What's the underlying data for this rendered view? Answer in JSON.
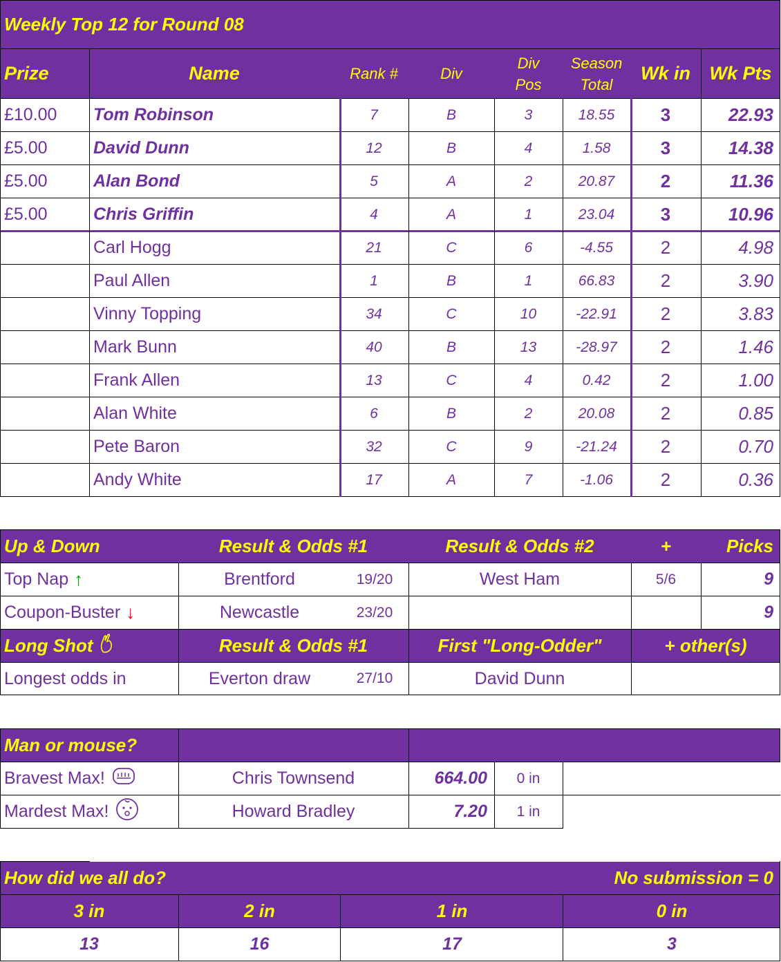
{
  "title": "Weekly Top 12 for Round 08",
  "top12": {
    "headers": {
      "prize": "Prize",
      "name": "Name",
      "rank": "Rank #",
      "div": "Div",
      "divpos_1": "Div",
      "divpos_2": "Pos",
      "season_1": "Season",
      "season_2": "Total",
      "wkin": "Wk in",
      "wkpts": "Wk Pts"
    },
    "rows": [
      {
        "prize": "£10.00",
        "name": "Tom Robinson",
        "rank": "7",
        "div": "B",
        "divpos": "3",
        "season": "18.55",
        "wkin": "3",
        "wkpts": "22.93"
      },
      {
        "prize": "£5.00",
        "name": "David Dunn",
        "rank": "12",
        "div": "B",
        "divpos": "4",
        "season": "1.58",
        "wkin": "3",
        "wkpts": "14.38"
      },
      {
        "prize": "£5.00",
        "name": "Alan Bond",
        "rank": "5",
        "div": "A",
        "divpos": "2",
        "season": "20.87",
        "wkin": "2",
        "wkpts": "11.36"
      },
      {
        "prize": "£5.00",
        "name": "Chris Griffin",
        "rank": "4",
        "div": "A",
        "divpos": "1",
        "season": "23.04",
        "wkin": "3",
        "wkpts": "10.96"
      },
      {
        "prize": "",
        "name": "Carl Hogg",
        "rank": "21",
        "div": "C",
        "divpos": "6",
        "season": "-4.55",
        "wkin": "2",
        "wkpts": "4.98"
      },
      {
        "prize": "",
        "name": "Paul Allen",
        "rank": "1",
        "div": "B",
        "divpos": "1",
        "season": "66.83",
        "wkin": "2",
        "wkpts": "3.90"
      },
      {
        "prize": "",
        "name": "Vinny Topping",
        "rank": "34",
        "div": "C",
        "divpos": "10",
        "season": "-22.91",
        "wkin": "2",
        "wkpts": "3.83"
      },
      {
        "prize": "",
        "name": "Mark Bunn",
        "rank": "40",
        "div": "B",
        "divpos": "13",
        "season": "-28.97",
        "wkin": "2",
        "wkpts": "1.46"
      },
      {
        "prize": "",
        "name": "Frank Allen",
        "rank": "13",
        "div": "C",
        "divpos": "4",
        "season": "0.42",
        "wkin": "2",
        "wkpts": "1.00"
      },
      {
        "prize": "",
        "name": "Alan White",
        "rank": "6",
        "div": "B",
        "divpos": "2",
        "season": "20.08",
        "wkin": "2",
        "wkpts": "0.85"
      },
      {
        "prize": "",
        "name": "Pete Baron",
        "rank": "32",
        "div": "C",
        "divpos": "9",
        "season": "-21.24",
        "wkin": "2",
        "wkpts": "0.70"
      },
      {
        "prize": "",
        "name": "Andy White",
        "rank": "17",
        "div": "A",
        "divpos": "7",
        "season": "-1.06",
        "wkin": "2",
        "wkpts": "0.36"
      }
    ]
  },
  "updown": {
    "header": {
      "label": "Up & Down",
      "res1": "Result & Odds #1",
      "res2": "Result & Odds #2",
      "plus": "+",
      "picks": "Picks"
    },
    "topnap": {
      "label": "Top Nap",
      "arrow": "↑",
      "team1": "Brentford",
      "odds1": "19/20",
      "team2": "West Ham",
      "odds2": "5/6",
      "picks": "9"
    },
    "buster": {
      "label": "Coupon-Buster",
      "arrow": "↓",
      "team1": "Newcastle",
      "odds1": "23/20",
      "team2": "",
      "odds2": "",
      "picks": "9"
    },
    "longshot_header": {
      "label": "Long Shot",
      "icon": "crossed-fingers-icon",
      "res1": "Result & Odds #1",
      "first": "First \"Long-Odder\"",
      "others": "+ other(s)"
    },
    "longshot": {
      "label": "Longest odds in",
      "team": "Everton draw",
      "odds": "27/10",
      "name": "David Dunn",
      "others": ""
    }
  },
  "manmouse": {
    "header": "Man or mouse?",
    "bravest": {
      "label": "Bravest Max!",
      "icon": "fist-icon",
      "name": "Chris Townsend",
      "value": "664.00",
      "in": "0 in"
    },
    "mardest": {
      "label": "Mardest Max!",
      "icon": "baby-face-icon",
      "name": "Howard Bradley",
      "value": "7.20",
      "in": "1 in"
    }
  },
  "howdid": {
    "header": "How did we all do?",
    "note": "No submission = 0",
    "cols": [
      "3 in",
      "2 in",
      "1 in",
      "0 in"
    ],
    "counts": [
      "13",
      "16",
      "17",
      "3"
    ]
  },
  "colors": {
    "purple": "#7030a0",
    "yellow": "#ffff00",
    "up": "#00a000",
    "down": "#ff0000"
  }
}
